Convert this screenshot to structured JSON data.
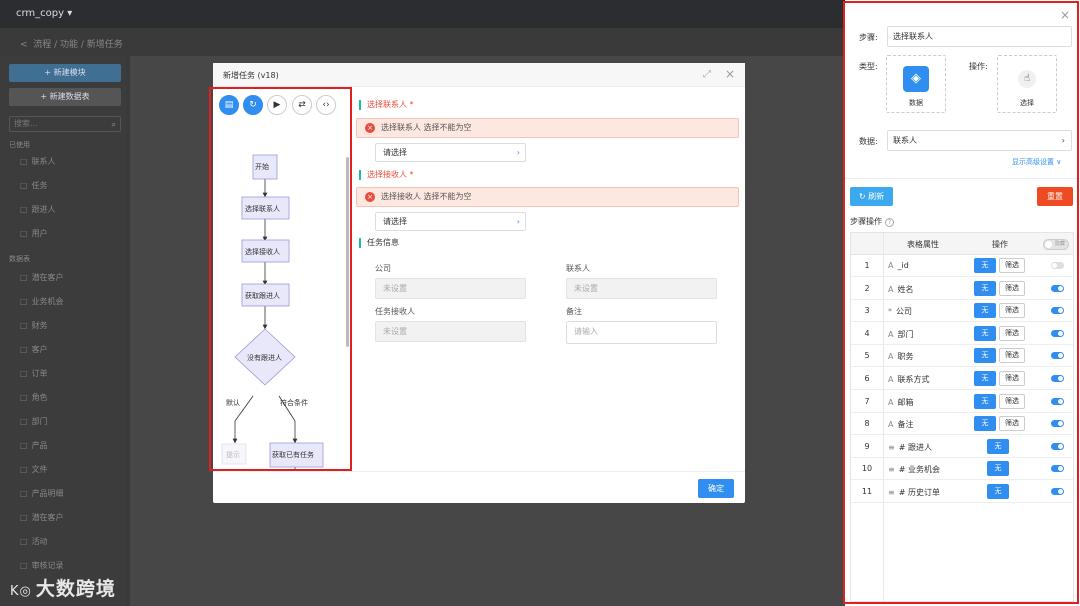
{
  "background_app": {
    "name": "crm_copy",
    "breadcrumb": "流程 / 功能 / 新增任务",
    "sidebar_buttons": [
      "新建模块",
      "新建数据表"
    ],
    "search_placeholder": "搜索...",
    "groups": [
      "已使用",
      "数据表"
    ],
    "items_used": [
      "联系人",
      "任务",
      "跟进人",
      "用户"
    ],
    "items_tables": [
      "潜在客户",
      "业务机会",
      "财务",
      "客户",
      "订单",
      "角色",
      "部门",
      "产品",
      "文件",
      "产品明细",
      "潜在客户",
      "活动",
      "审核记录"
    ]
  },
  "watermark": "大数跨境",
  "watermark_logo": "K◎",
  "modal": {
    "title": "新增任务 (v18)",
    "confirm_label": "确定",
    "flow": {
      "nodes": [
        "开始",
        "选择联系人",
        "选择接收人",
        "获取跟进人",
        "没有跟进人",
        "提示",
        "获取已有任务"
      ],
      "edge_labels": [
        "默认",
        "符合条件"
      ]
    },
    "sections": {
      "contact_title": "选择联系人 *",
      "contact_error": "选择联系人 选择不能为空",
      "receiver_title": "选择接收人 *",
      "receiver_error": "选择接收人 选择不能为空",
      "picker_placeholder": "请选择",
      "task_info_title": "任务信息"
    },
    "fields": {
      "company_label": "公司",
      "company_value": "未设置",
      "contact_label": "联系人",
      "contact_value": "未设置",
      "receiver_label": "任务接收人",
      "receiver_value": "未设置",
      "note_label": "备注",
      "note_placeholder": "请输入"
    }
  },
  "panel": {
    "step_label": "步骤:",
    "step_value": "选择联系人",
    "type_label": "类型:",
    "type_value": "数据",
    "action_label": "操作:",
    "action_value": "选择",
    "data_label": "数据:",
    "data_value": "联系人",
    "advanced_link": "显示高级设置 ∨",
    "refresh_label": "刷新",
    "reset_label": "重置",
    "step_ops_label": "步骤操作",
    "table_headers": {
      "attr": "表格属性",
      "op": "操作"
    },
    "toggle_all_label": "隐藏",
    "rows": [
      {
        "num": "1",
        "icon": "A",
        "field": "_id",
        "btn_wu": "无",
        "btn_sx": "筛选",
        "switch_on": false
      },
      {
        "num": "2",
        "icon": "A",
        "field": "姓名",
        "btn_wu": "无",
        "btn_sx": "筛选",
        "switch_on": true
      },
      {
        "num": "3",
        "icon": "*",
        "field": "公司",
        "btn_wu": "无",
        "btn_sx": "筛选",
        "switch_on": true
      },
      {
        "num": "4",
        "icon": "A",
        "field": "部门",
        "btn_wu": "无",
        "btn_sx": "筛选",
        "switch_on": true
      },
      {
        "num": "5",
        "icon": "A",
        "field": "职务",
        "btn_wu": "无",
        "btn_sx": "筛选",
        "switch_on": true
      },
      {
        "num": "6",
        "icon": "A",
        "field": "联系方式",
        "btn_wu": "无",
        "btn_sx": "筛选",
        "switch_on": true
      },
      {
        "num": "7",
        "icon": "A",
        "field": "邮箱",
        "btn_wu": "无",
        "btn_sx": "筛选",
        "switch_on": true
      },
      {
        "num": "8",
        "icon": "A",
        "field": "备注",
        "btn_wu": "无",
        "btn_sx": "筛选",
        "switch_on": true
      },
      {
        "num": "9",
        "icon": "≡",
        "field": "# 跟进人",
        "btn_wu": "无",
        "btn_sx": "",
        "switch_on": true
      },
      {
        "num": "10",
        "icon": "≡",
        "field": "# 业务机会",
        "btn_wu": "无",
        "btn_sx": "",
        "switch_on": true
      },
      {
        "num": "11",
        "icon": "≡",
        "field": "# 历史订单",
        "btn_wu": "无",
        "btn_sx": "",
        "switch_on": true
      }
    ]
  },
  "colors": {
    "accent": "#2f8ef0",
    "danger": "#ee4b22",
    "highlight_frame": "#e02020"
  }
}
